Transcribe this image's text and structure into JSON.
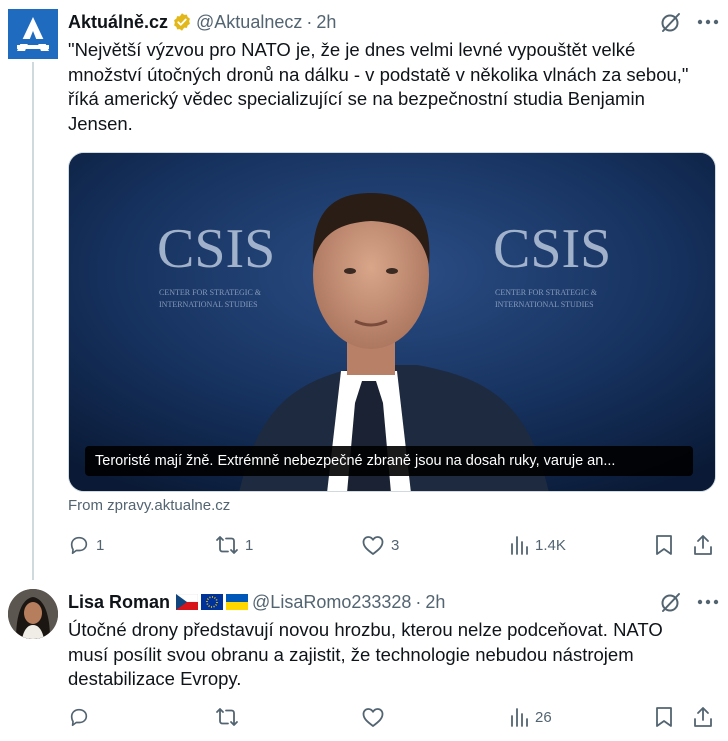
{
  "tweets": [
    {
      "author": "Aktuálně.cz",
      "handle": "@Aktualnecz",
      "separator": "·",
      "time": "2h",
      "text": "\"Největší výzvou pro NATO je, že je dnes velmi levné vypouštět velké\nmnožství útočných dronů na dálku - v podstatě v několika vlnách za sebou,\"\nříká americký vědec specializující se na bezpečnostní studia Benjamin\nJensen.",
      "media": {
        "backdrop_text": "CSIS",
        "backdrop_subtext_1": "CENTER FOR STRATEGIC &",
        "backdrop_subtext_2": "INTERNATIONAL STUDIES",
        "caption": "Teroristé mají žně. Extrémně nebezpečné zbraně jsou na dosah ruky, varuje an..."
      },
      "source": "From zpravy.aktualne.cz",
      "stats": {
        "replies": "1",
        "reposts": "1",
        "likes": "3",
        "views": "1.4K"
      }
    },
    {
      "author": "Lisa Roman",
      "handle": "@LisaRomo233328",
      "separator": "·",
      "time": "2h",
      "text": "Útočné drony představují novou hrozbu, kterou nelze podceňovat. NATO\nmusí posílit svou obranu a zajistit, že technologie nebudou nástrojem\ndestabilizace Evropy.",
      "flags": [
        "czech-flag",
        "eu-flag",
        "ukraine-flag"
      ],
      "stats": {
        "replies": "",
        "reposts": "",
        "likes": "",
        "views": "26"
      }
    }
  ],
  "colors": {
    "text": "#0f1419",
    "muted": "#536471",
    "verified": "#e2b719",
    "logo": "#1f6bbf",
    "thread_line": "#cfd9de"
  },
  "icons": [
    "aktualne-logo-icon",
    "verified-gold-icon",
    "grok-icon",
    "more-icon",
    "reply-icon",
    "repost-icon",
    "like-icon",
    "views-icon",
    "bookmark-icon",
    "share-icon"
  ]
}
